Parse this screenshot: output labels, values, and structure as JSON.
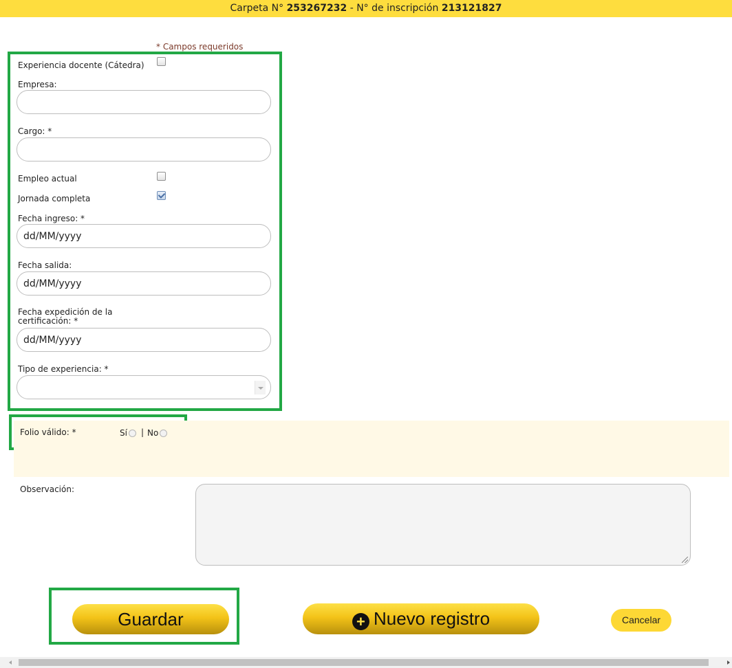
{
  "header": {
    "carpeta_label": "Carpeta N°",
    "carpeta_number": "253267232",
    "inscripcion_label": "- N° de inscripción",
    "inscripcion_number": "213121827"
  },
  "form": {
    "required_note": "* Campos requeridos",
    "experiencia_docente_label": "Experiencia docente (Cátedra)",
    "experiencia_docente_checked": false,
    "empresa_label": "Empresa:",
    "empresa_value": "",
    "cargo_label": "Cargo: *",
    "cargo_value": "",
    "empleo_actual_label": "Empleo actual",
    "empleo_actual_checked": false,
    "jornada_completa_label": "Jornada completa",
    "jornada_completa_checked": true,
    "fecha_ingreso_label": "Fecha ingreso: *",
    "fecha_ingreso_placeholder": "dd/MM/yyyy",
    "fecha_salida_label": "Fecha salida:",
    "fecha_salida_placeholder": "dd/MM/yyyy",
    "fecha_expedicion_label": "Fecha expedición de la certificación: *",
    "fecha_expedicion_placeholder": "dd/MM/yyyy",
    "tipo_experiencia_label": "Tipo de experiencia: *",
    "tipo_experiencia_value": ""
  },
  "folio": {
    "label": "Folio válido: *",
    "si_label": "Sí",
    "separator": "|",
    "no_label": "No"
  },
  "observacion": {
    "label": "Observación:",
    "value": ""
  },
  "buttons": {
    "guardar": "Guardar",
    "nuevo_registro": "Nuevo registro",
    "cancelar": "Cancelar"
  },
  "colors": {
    "header_bg": "#fedd3e",
    "highlight_border": "#22a845",
    "button_gold": "#f3c318",
    "folio_band": "#fff9e6"
  }
}
